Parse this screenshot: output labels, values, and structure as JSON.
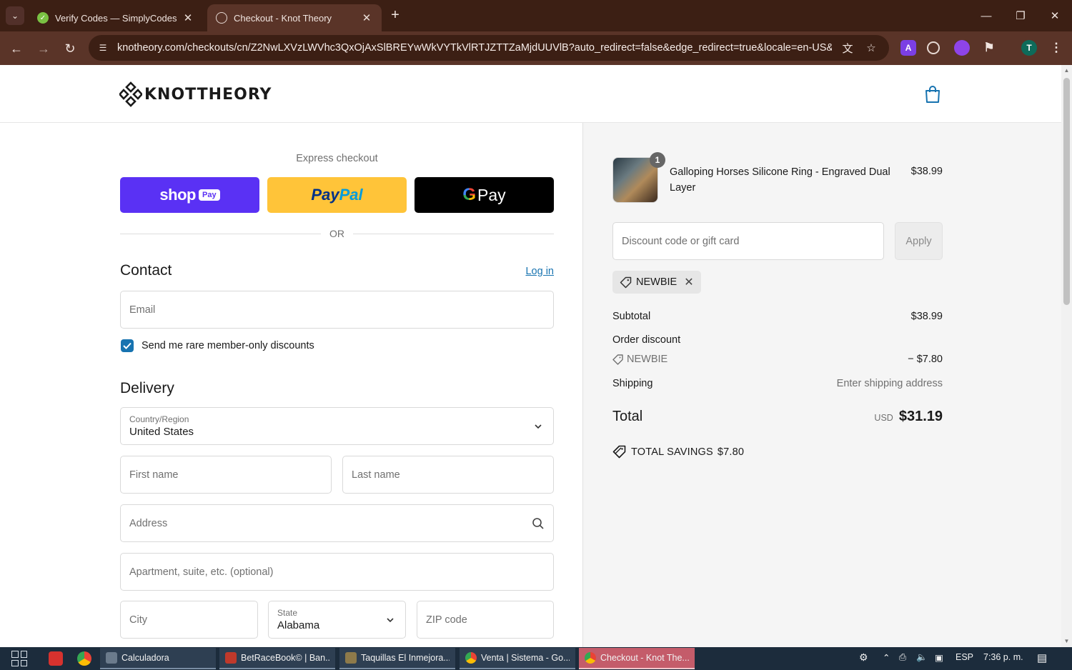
{
  "browser": {
    "tabs": [
      {
        "title": "Verify Codes — SimplyCodes",
        "active": false
      },
      {
        "title": "Checkout - Knot Theory",
        "active": true
      }
    ],
    "url": "knotheory.com/checkouts/cn/Z2NwLXVzLWVhc3QxOjAxSlBREYwWkVYTkVlRTJZTTZaMjdUUVlB?auto_redirect=false&edge_redirect=true&locale=en-US&...",
    "profile_initial": "T",
    "ext_letter": "A"
  },
  "header": {
    "brand": "KNOTTHEORY"
  },
  "express": {
    "title": "Express checkout",
    "shop_text": "shop",
    "shop_pay": "Pay",
    "paypal_p1": "Pay",
    "paypal_p2": "Pal",
    "gpay_g": "G",
    "gpay_pay": "Pay",
    "or": "OR"
  },
  "contact": {
    "title": "Contact",
    "login": "Log in",
    "email_placeholder": "Email",
    "marketing_label": "Send me rare member-only discounts",
    "marketing_checked": true
  },
  "delivery": {
    "title": "Delivery",
    "country_label": "Country/Region",
    "country_value": "United States",
    "first_name": "First name",
    "last_name": "Last name",
    "address": "Address",
    "apartment": "Apartment, suite, etc. (optional)",
    "city": "City",
    "state_label": "State",
    "state_value": "Alabama",
    "zip": "ZIP code"
  },
  "summary": {
    "product_name": "Galloping Horses Silicone Ring - Engraved Dual Layer",
    "product_qty": "1",
    "product_price": "$38.99",
    "discount_placeholder": "Discount code or gift card",
    "apply": "Apply",
    "applied_code": "NEWBIE",
    "subtotal_label": "Subtotal",
    "subtotal_value": "$38.99",
    "order_discount_label": "Order discount",
    "discount_code": "NEWBIE",
    "discount_value": "− $7.80",
    "shipping_label": "Shipping",
    "shipping_value": "Enter shipping address",
    "total_label": "Total",
    "currency": "USD",
    "total_value": "$31.19",
    "savings_label": "TOTAL SAVINGS",
    "savings_value": "$7.80"
  },
  "taskbar": {
    "items": [
      {
        "title": "Calculadora",
        "active": false
      },
      {
        "title": "BetRaceBook© | Ban...",
        "active": false
      },
      {
        "title": "Taquillas El Inmejora...",
        "active": false
      },
      {
        "title": "Venta | Sistema - Go...",
        "active": false
      },
      {
        "title": "Checkout - Knot The...",
        "active": true
      }
    ],
    "lang": "ESP",
    "time": "7:36 p. m."
  },
  "colors": {
    "shop_pay": "#5a31f4",
    "paypal": "#ffc439",
    "gpay": "#000000",
    "link": "#1773b0",
    "browser_frame": "#3c1f14"
  }
}
